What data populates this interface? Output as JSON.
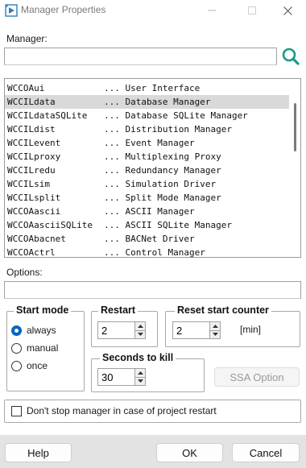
{
  "window": {
    "title": "Manager Properties",
    "controls": {
      "minimize": "–",
      "maximize": "☐",
      "close": "✕"
    }
  },
  "manager": {
    "label": "Manager:",
    "value": "",
    "search_icon": "search-icon"
  },
  "managers": [
    {
      "name": "WCCOAui",
      "desc": "... User Interface"
    },
    {
      "name": "WCCILdata",
      "desc": "... Database Manager",
      "selected": true
    },
    {
      "name": "WCCILdataSQLite",
      "desc": "... Database SQLite Manager"
    },
    {
      "name": "WCCILdist",
      "desc": "... Distribution Manager"
    },
    {
      "name": "WCCILevent",
      "desc": "... Event Manager"
    },
    {
      "name": "WCCILproxy",
      "desc": "... Multiplexing Proxy"
    },
    {
      "name": "WCCILredu",
      "desc": "... Redundancy Manager"
    },
    {
      "name": "WCCILsim",
      "desc": "... Simulation Driver"
    },
    {
      "name": "WCCILsplit",
      "desc": "... Split Mode Manager"
    },
    {
      "name": "WCCOAascii",
      "desc": "... ASCII Manager"
    },
    {
      "name": "WCCOAasciiSQLite",
      "desc": "... ASCII SQLite Manager"
    },
    {
      "name": "WCCOAbacnet",
      "desc": "... BACNet Driver"
    },
    {
      "name": "WCCOActrl",
      "desc": "... Control Manager"
    }
  ],
  "options": {
    "label": "Options:",
    "value": ""
  },
  "start_mode": {
    "title": "Start mode",
    "options": [
      {
        "label": "always",
        "checked": true
      },
      {
        "label": "manual",
        "checked": false
      },
      {
        "label": "once",
        "checked": false
      }
    ]
  },
  "restart": {
    "title": "Restart",
    "value": "2"
  },
  "reset_counter": {
    "title": "Reset start counter",
    "value": "2",
    "unit": "[min]"
  },
  "seconds_to_kill": {
    "title": "Seconds to kill",
    "value": "30"
  },
  "ssa_button": "SSA Option",
  "dont_stop": {
    "label": "Don't stop manager in case of project restart",
    "checked": false
  },
  "buttons": {
    "help": "Help",
    "ok": "OK",
    "cancel": "Cancel"
  },
  "colors": {
    "accent": "#0067c0",
    "search_icon": "#1a9a8a",
    "selection": "#d9d9d9"
  }
}
